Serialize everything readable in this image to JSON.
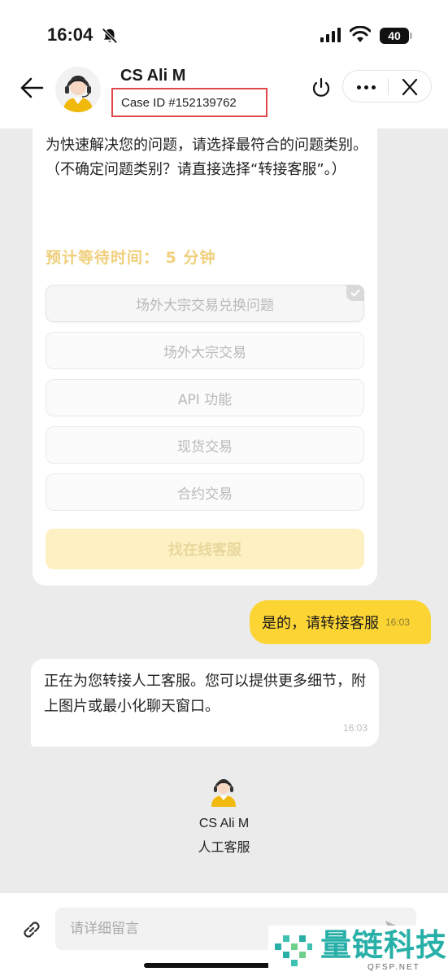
{
  "status_bar": {
    "time": "16:04",
    "battery": "40"
  },
  "header": {
    "agent_name": "CS Ali M",
    "case_id": "Case ID #152139762"
  },
  "bot_card": {
    "intro": "为快速解决您的问题，请选择最符合的问题类别。",
    "hint": "（不确定问题类别？请直接选择“转接客服”。）",
    "wait_label": "预计等待时间：",
    "wait_value": "5 分钟",
    "options": [
      {
        "label": "场外大宗交易兑换问题",
        "selected": true
      },
      {
        "label": "场外大宗交易",
        "selected": false
      },
      {
        "label": "API 功能",
        "selected": false
      },
      {
        "label": "现货交易",
        "selected": false
      },
      {
        "label": "合约交易",
        "selected": false
      }
    ],
    "online_button": "找在线客服"
  },
  "messages": {
    "user": {
      "text": "是的，请转接客服",
      "time": "16:03"
    },
    "agent": {
      "text": "正在为您转接人工客服。您可以提供更多细节，附上图片或最小化聊天窗口。",
      "time": "16:03"
    }
  },
  "agent_info": {
    "name": "CS Ali M",
    "role": "人工客服"
  },
  "input": {
    "placeholder": "请详细留言"
  },
  "watermark": {
    "text": "量链科技",
    "sub": "QFSP.NET"
  },
  "colors": {
    "accent": "#fcd535",
    "case_box_border": "#e0474c",
    "wait_text": "#f0cf7a",
    "watermark": "#28b0a8"
  }
}
